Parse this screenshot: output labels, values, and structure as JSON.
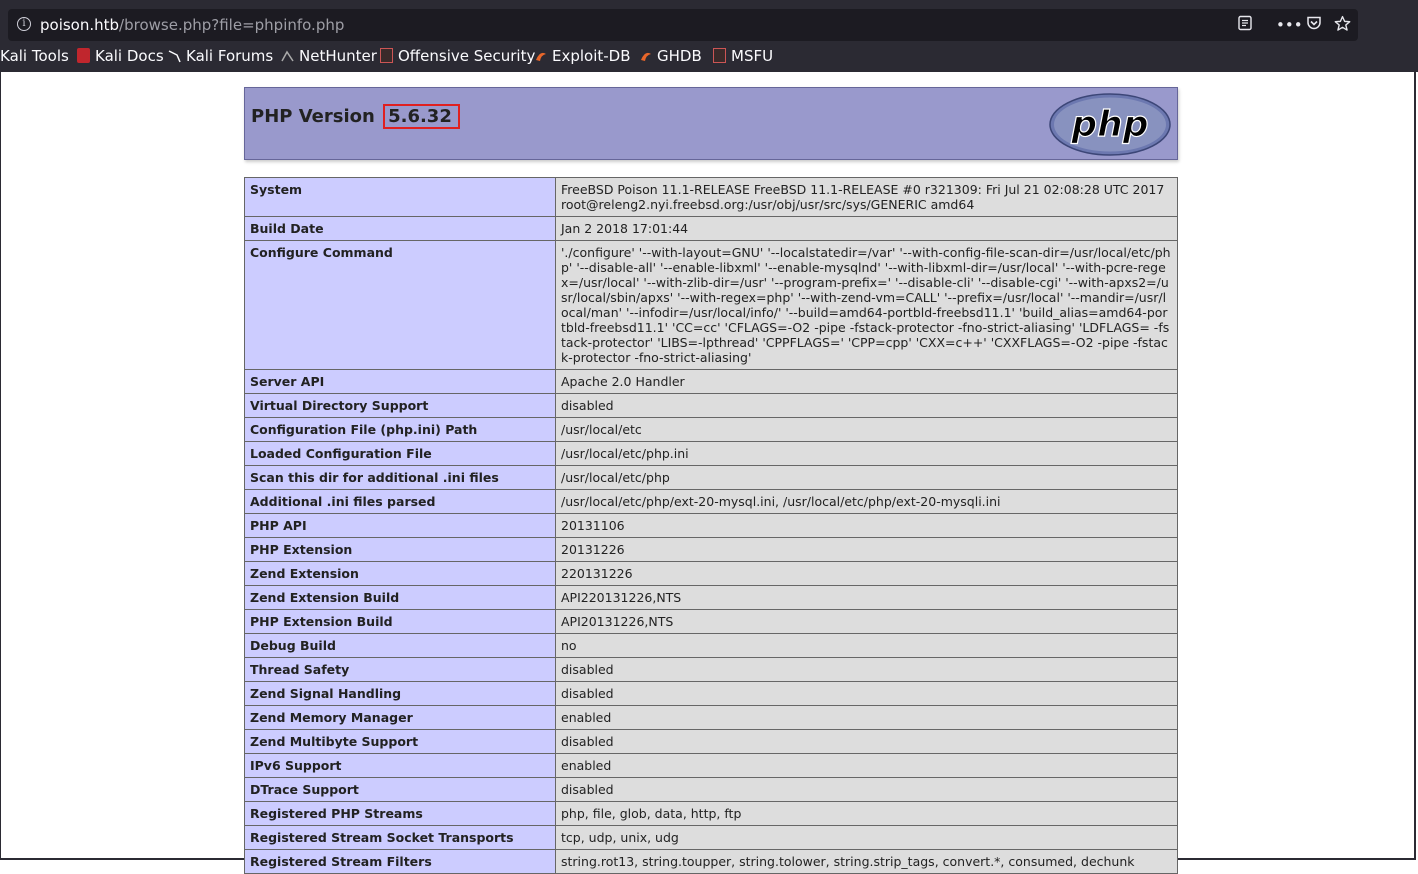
{
  "browser": {
    "url_host": "poison.htb",
    "url_path": "/browse.php?file=phpinfo.php",
    "bookmarks": [
      "Kali Tools",
      "Kali Docs",
      "Kali Forums",
      "NetHunter",
      "Offensive Security",
      "Exploit-DB",
      "GHDB",
      "MSFU"
    ]
  },
  "header": {
    "title_prefix": "PHP Version ",
    "version": "5.6.32",
    "logo_text": "php"
  },
  "rows": [
    {
      "key": "System",
      "value": "FreeBSD Poison 11.1-RELEASE FreeBSD 11.1-RELEASE #0 r321309: Fri Jul 21 02:08:28 UTC 2017 root@releng2.nyi.freebsd.org:/usr/obj/usr/src/sys/GENERIC amd64"
    },
    {
      "key": "Build Date",
      "value": "Jan 2 2018 17:01:44"
    },
    {
      "key": "Configure Command",
      "value": "'./configure' '--with-layout=GNU' '--localstatedir=/var' '--with-config-file-scan-dir=/usr/local/etc/php' '--disable-all' '--enable-libxml' '--enable-mysqlnd' '--with-libxml-dir=/usr/local' '--with-pcre-regex=/usr/local' '--with-zlib-dir=/usr' '--program-prefix=' '--disable-cli' '--disable-cgi' '--with-apxs2=/usr/local/sbin/apxs' '--with-regex=php' '--with-zend-vm=CALL' '--prefix=/usr/local' '--mandir=/usr/local/man' '--infodir=/usr/local/info/' '--build=amd64-portbld-freebsd11.1' 'build_alias=amd64-portbld-freebsd11.1' 'CC=cc' 'CFLAGS=-O2 -pipe -fstack-protector -fno-strict-aliasing' 'LDFLAGS= -fstack-protector' 'LIBS=-lpthread' 'CPPFLAGS=' 'CPP=cpp' 'CXX=c++' 'CXXFLAGS=-O2 -pipe -fstack-protector -fno-strict-aliasing'"
    },
    {
      "key": "Server API",
      "value": "Apache 2.0 Handler"
    },
    {
      "key": "Virtual Directory Support",
      "value": "disabled"
    },
    {
      "key": "Configuration File (php.ini) Path",
      "value": "/usr/local/etc"
    },
    {
      "key": "Loaded Configuration File",
      "value": "/usr/local/etc/php.ini"
    },
    {
      "key": "Scan this dir for additional .ini files",
      "value": "/usr/local/etc/php"
    },
    {
      "key": "Additional .ini files parsed",
      "value": "/usr/local/etc/php/ext-20-mysql.ini, /usr/local/etc/php/ext-20-mysqli.ini"
    },
    {
      "key": "PHP API",
      "value": "20131106"
    },
    {
      "key": "PHP Extension",
      "value": "20131226"
    },
    {
      "key": "Zend Extension",
      "value": "220131226"
    },
    {
      "key": "Zend Extension Build",
      "value": "API220131226,NTS"
    },
    {
      "key": "PHP Extension Build",
      "value": "API20131226,NTS"
    },
    {
      "key": "Debug Build",
      "value": "no"
    },
    {
      "key": "Thread Safety",
      "value": "disabled"
    },
    {
      "key": "Zend Signal Handling",
      "value": "disabled"
    },
    {
      "key": "Zend Memory Manager",
      "value": "enabled"
    },
    {
      "key": "Zend Multibyte Support",
      "value": "disabled"
    },
    {
      "key": "IPv6 Support",
      "value": "enabled"
    },
    {
      "key": "DTrace Support",
      "value": "disabled"
    },
    {
      "key": "Registered PHP Streams",
      "value": "php, file, glob, data, http, ftp"
    },
    {
      "key": "Registered Stream Socket Transports",
      "value": "tcp, udp, unix, udg"
    },
    {
      "key": "Registered Stream Filters",
      "value": "string.rot13, string.toupper, string.tolower, string.strip_tags, convert.*, consumed, dechunk"
    }
  ]
}
